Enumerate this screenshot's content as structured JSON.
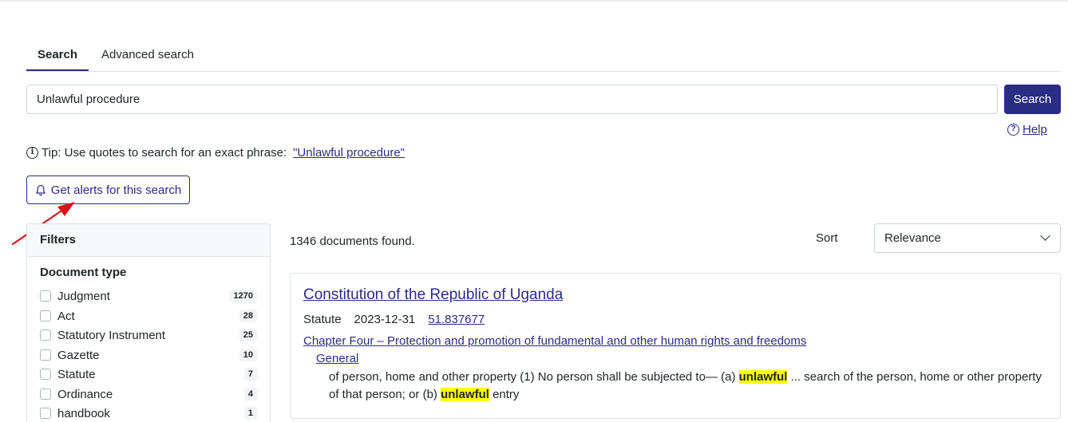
{
  "tabs": [
    {
      "label": "Search",
      "active": true
    },
    {
      "label": "Advanced search",
      "active": false
    }
  ],
  "search": {
    "value": "Unlawful procedure",
    "button": "Search"
  },
  "help": {
    "icon": "question-circle-icon",
    "label": "Help"
  },
  "tip": {
    "icon": "info-circle-icon",
    "text": "Tip: Use quotes to search for an exact phrase:",
    "link": "\"Unlawful procedure\""
  },
  "alerts": {
    "icon": "bell-icon",
    "label": "Get alerts for this search"
  },
  "filters": {
    "title": "Filters",
    "subtitle": "Document type",
    "items": [
      {
        "label": "Judgment",
        "count": "1270"
      },
      {
        "label": "Act",
        "count": "28"
      },
      {
        "label": "Statutory Instrument",
        "count": "25"
      },
      {
        "label": "Gazette",
        "count": "10"
      },
      {
        "label": "Statute",
        "count": "7"
      },
      {
        "label": "Ordinance",
        "count": "4"
      },
      {
        "label": "handbook",
        "count": "1"
      }
    ]
  },
  "results": {
    "found": "1346 documents found.",
    "sort_label": "Sort",
    "sort_value": "Relevance",
    "item": {
      "title": "Constitution of the Republic of Uganda",
      "type": "Statute",
      "date": "2023-12-31",
      "score": "51.837677",
      "chapter": "Chapter Four – Protection and promotion of fundamental and other human rights and freedoms",
      "part": "General",
      "snippet_1": "of person, home and other property (1) No person shall be subjected to— (a) ",
      "highlight_1": "unlawful",
      "snippet_2": " ... search of the person, home or other property of that person; or (b) ",
      "highlight_2": "unlawful",
      "snippet_3": " entry"
    }
  },
  "colors": {
    "accent": "#2b2c83",
    "highlight": "#ffff00",
    "annotation": "#d9141b"
  }
}
